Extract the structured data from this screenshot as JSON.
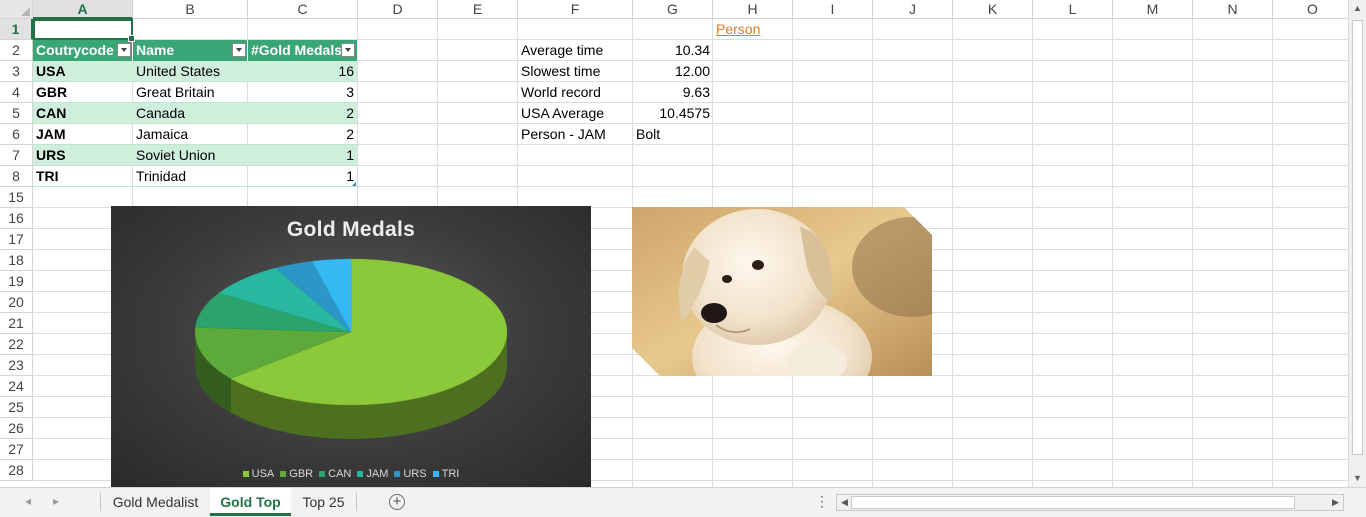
{
  "columns": [
    "A",
    "B",
    "C",
    "D",
    "E",
    "F",
    "G",
    "H",
    "I",
    "J",
    "K",
    "L",
    "M",
    "N",
    "O"
  ],
  "rows": [
    "1",
    "2",
    "3",
    "4",
    "5",
    "6",
    "7",
    "8",
    "15",
    "16",
    "17",
    "18",
    "19",
    "20",
    "21",
    "22",
    "23",
    "24",
    "25",
    "26",
    "27",
    "28"
  ],
  "active_cell": {
    "column": "A",
    "row": "1"
  },
  "table": {
    "headers": [
      "Coutrycode",
      "Name",
      "#Gold Medals"
    ],
    "rows": [
      [
        "USA",
        "United States",
        "16"
      ],
      [
        "GBR",
        "Great Britain",
        "3"
      ],
      [
        "CAN",
        "Canada",
        "2"
      ],
      [
        "JAM",
        "Jamaica",
        "2"
      ],
      [
        "URS",
        "Soviet Union",
        "1"
      ],
      [
        "TRI",
        "Trinidad",
        "1"
      ]
    ]
  },
  "stats": {
    "labels": [
      "Average time",
      "Slowest time",
      "World record",
      "USA Average",
      "Person - JAM"
    ],
    "values": [
      "10.34",
      "12.00",
      "9.63",
      "10.4575",
      "Bolt"
    ]
  },
  "h1_link": "Person",
  "chart_data": {
    "type": "pie",
    "title": "Gold Medals",
    "categories": [
      "USA",
      "GBR",
      "CAN",
      "JAM",
      "URS",
      "TRI"
    ],
    "values": [
      16,
      3,
      2,
      2,
      1,
      1
    ],
    "colors": [
      "#8bc93b",
      "#5daa3a",
      "#2ba36c",
      "#29b7a0",
      "#2b97c7",
      "#35b9f2"
    ],
    "legend": "bottom"
  },
  "image": {
    "subject": "puppy-photo"
  },
  "sheet_tabs": [
    "Gold Medalist",
    "Gold Top",
    "Top 25"
  ],
  "active_tab": "Gold Top",
  "colors": {
    "accent": "#217346",
    "table_header": "#3aa575",
    "table_band": "#d0eedc",
    "link": "#e07b1d",
    "chart_bg": "#3b3b3b"
  }
}
